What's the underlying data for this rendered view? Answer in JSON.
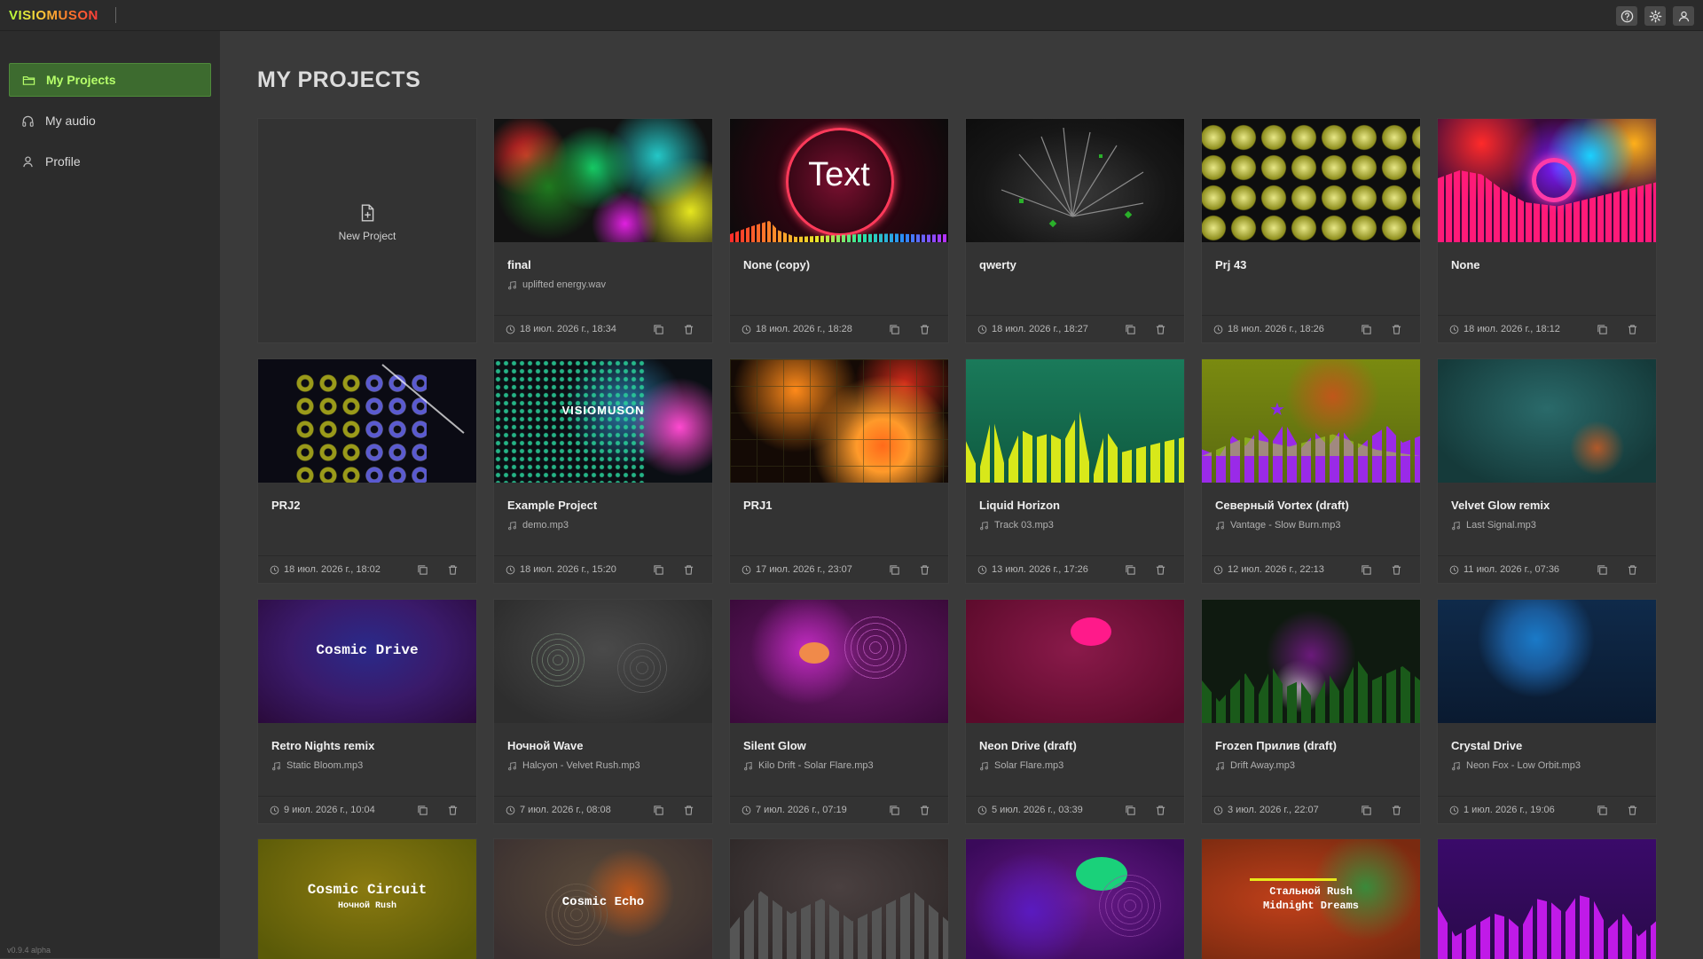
{
  "app": {
    "logo": "VISIOMUSON",
    "version": "v0.9.4 alpha",
    "colors": {
      "accent": "#b6ff6a",
      "active_bg": "#3d6b2f"
    }
  },
  "top_icons": [
    "help-icon",
    "gear-icon",
    "user-icon"
  ],
  "sidebar": {
    "items": [
      {
        "label": "My Projects",
        "icon": "folder-icon",
        "active": true
      },
      {
        "label": "My audio",
        "icon": "headphones-icon",
        "active": false
      },
      {
        "label": "Profile",
        "icon": "user-icon",
        "active": false
      }
    ]
  },
  "page": {
    "title": "MY PROJECTS"
  },
  "new_project": {
    "label": "New Project"
  },
  "projects": [
    {
      "title": "final",
      "audio": "uplifted energy.wav",
      "date": "18 июл. 2026 г., 18:34"
    },
    {
      "title": "None (copy)",
      "audio": "",
      "date": "18 июл. 2026 г., 18:28",
      "thumb_text": "Text"
    },
    {
      "title": "qwerty",
      "audio": "",
      "date": "18 июл. 2026 г., 18:27"
    },
    {
      "title": "Prj 43",
      "audio": "",
      "date": "18 июл. 2026 г., 18:26"
    },
    {
      "title": "None",
      "audio": "",
      "date": "18 июл. 2026 г., 18:12"
    },
    {
      "title": "PRJ2",
      "audio": "",
      "date": "18 июл. 2026 г., 18:02"
    },
    {
      "title": "Example Project",
      "audio": "demo.mp3",
      "date": "18 июл. 2026 г., 15:20",
      "thumb_text": "VISIOMUSON"
    },
    {
      "title": "PRJ1",
      "audio": "",
      "date": "17 июл. 2026 г., 23:07"
    },
    {
      "title": "Liquid Horizon",
      "audio": "Track 03.mp3",
      "date": "13 июл. 2026 г., 17:26"
    },
    {
      "title": "Северный Vortex (draft)",
      "audio": "Vantage - Slow Burn.mp3",
      "date": "12 июл. 2026 г., 22:13"
    },
    {
      "title": "Velvet Glow remix",
      "audio": "Last Signal.mp3",
      "date": "11 июл. 2026 г., 07:36"
    },
    {
      "title": "Retro Nights remix",
      "audio": "Static Bloom.mp3",
      "date": "9 июл. 2026 г., 10:04",
      "thumb_text": "Cosmic Drive"
    },
    {
      "title": "Ночной Wave",
      "audio": "Halcyon - Velvet Rush.mp3",
      "date": "7 июл. 2026 г., 08:08"
    },
    {
      "title": "Silent Glow",
      "audio": "Kilo Drift - Solar Flare.mp3",
      "date": "7 июл. 2026 г., 07:19"
    },
    {
      "title": "Neon Drive (draft)",
      "audio": "Solar Flare.mp3",
      "date": "5 июл. 2026 г., 03:39"
    },
    {
      "title": "Frozen Прилив (draft)",
      "audio": "Drift Away.mp3",
      "date": "3 июл. 2026 г., 22:07"
    },
    {
      "title": "Crystal Drive",
      "audio": "Neon Fox - Low Orbit.mp3",
      "date": "1 июл. 2026 г., 19:06"
    }
  ],
  "partial_thumbs": [
    {
      "line1": "Cosmic Circuit",
      "line2": "Ночной Rush"
    },
    {
      "line1": "Cosmic Echo",
      "line2": ""
    },
    {
      "line1": "",
      "line2": ""
    },
    {
      "line1": "",
      "line2": ""
    },
    {
      "line1": "Стальной Rush",
      "line2": "Midnight Dreams"
    },
    {
      "line1": "",
      "line2": ""
    }
  ]
}
